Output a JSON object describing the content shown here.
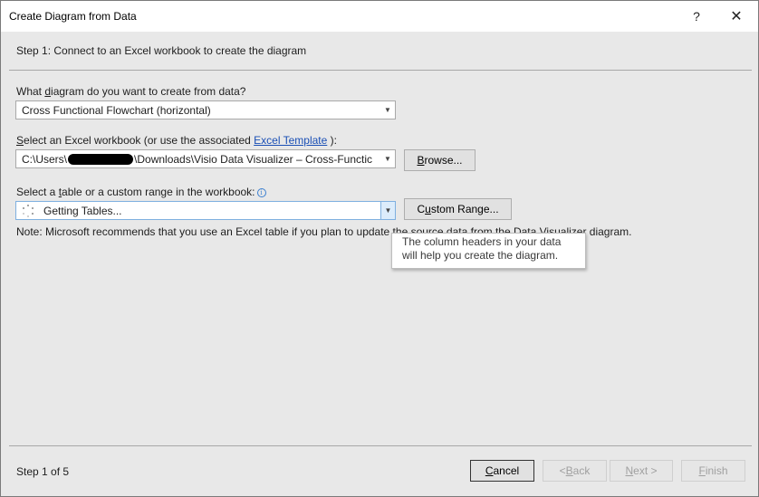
{
  "window": {
    "title": "Create Diagram from Data",
    "help": "?",
    "close": "✕"
  },
  "step_heading": "Step 1: Connect to an Excel workbook to create the diagram",
  "diagram_question": {
    "pre": "What ",
    "accel": "d",
    "post": "iagram do you want to create from data?"
  },
  "diagram_select": {
    "value": "Cross Functional Flowchart (horizontal)"
  },
  "workbook_label": {
    "pre": "",
    "accel": "S",
    "post": "elect an Excel workbook (or use the associated ",
    "link": "Excel Template",
    "tail": " ):"
  },
  "workbook_select": {
    "value_start": "C:\\Users\\",
    "value_end": "\\Downloads\\Visio Data Visualizer – Cross-Functic"
  },
  "browse_button": {
    "pre": "",
    "accel": "B",
    "post": "rowse..."
  },
  "table_label": {
    "pre": "Select a ",
    "accel": "t",
    "post": "able or a custom range in the workbook:"
  },
  "table_select": {
    "value": "Getting Tables..."
  },
  "custom_range_button": {
    "pre": "C",
    "accel": "u",
    "post": "stom Range..."
  },
  "note": "Note: Microsoft recommends that you use an Excel table if you plan to update the source data from the Data Visualizer diagram.",
  "tooltip": {
    "line1": "The column headers in your data",
    "line2": "will help you create the diagram."
  },
  "footer": {
    "step_counter": "Step 1 of 5",
    "cancel": {
      "accel": "C",
      "post": "ancel"
    },
    "back": {
      "pre": "< ",
      "accel": "B",
      "post": "ack"
    },
    "next": {
      "accel": "N",
      "post": "ext >"
    },
    "finish": {
      "accel": "F",
      "post": "inish"
    }
  },
  "icons": {
    "info": "info-icon",
    "dropdown": "chevron-down-icon",
    "spinner": "loading-spinner-icon"
  },
  "colors": {
    "link": "#1a4fb5",
    "info": "#3b7fd0",
    "focus_border": "#7fb0e0",
    "dialog_bg": "#e8e8e8"
  }
}
